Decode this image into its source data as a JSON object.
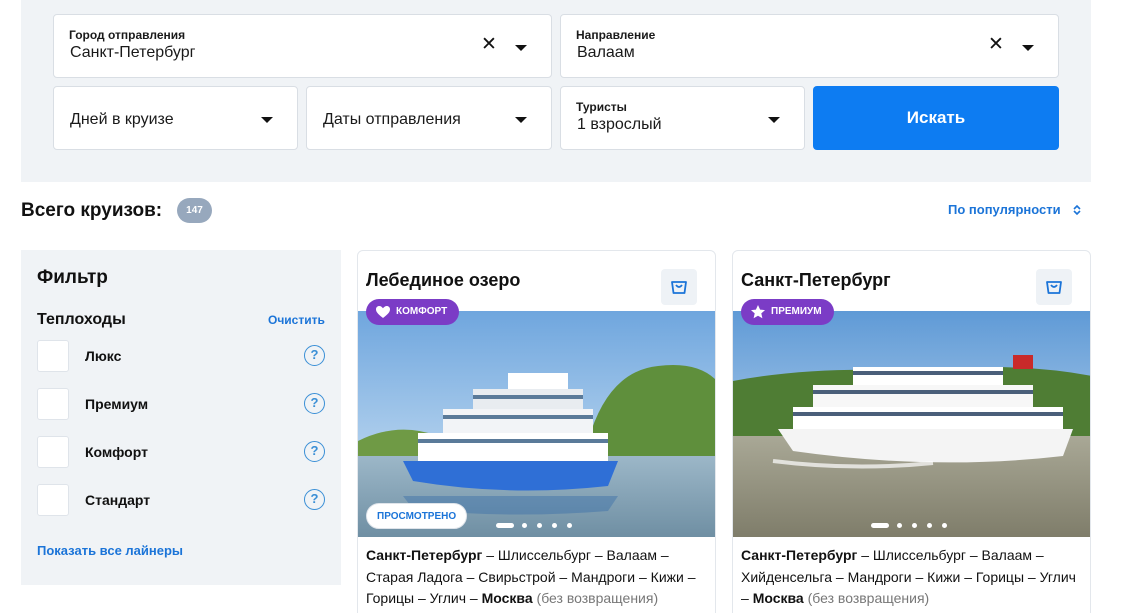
{
  "search": {
    "departure_label": "Город отправления",
    "departure_value": "Санкт-Петербург",
    "direction_label": "Направление",
    "direction_value": "Валаам",
    "days_placeholder": "Дней в круизе",
    "dates_placeholder": "Даты отправления",
    "tourists_label": "Туристы",
    "tourists_value": "1 взрослый",
    "search_button": "Искать",
    "clear_icon": "close-icon",
    "dropdown_icon": "chevron-down-icon"
  },
  "results": {
    "total_label": "Всего круизов:",
    "total_count": "147",
    "sort_label": "По популярности"
  },
  "filter": {
    "title": "Фильтр",
    "section_title": "Теплоходы",
    "clear_label": "Очистить",
    "options": [
      {
        "label": "Люкс",
        "help": "?"
      },
      {
        "label": "Премиум",
        "help": "?"
      },
      {
        "label": "Комфорт",
        "help": "?"
      },
      {
        "label": "Стандарт",
        "help": "?"
      }
    ],
    "show_all": "Показать все лайнеры"
  },
  "cards": [
    {
      "title": "Лебединое озеро",
      "tag": "КОМФОРТ",
      "tag_icon": "heart-icon",
      "tag_color": "#7b3cc6",
      "viewed": "ПРОСМОТРЕНО",
      "hull_color": "#2f6fd6",
      "route_start": "Санкт-Петербург",
      "route_middle": " – Шлиссельбург – Валаам – Старая Ладога – Свирьстрой – Мандроги – Кижи – Горицы – Углич – ",
      "route_end": "Москва",
      "route_note": " (без возвращения)"
    },
    {
      "title": "Санкт-Петербург",
      "tag": "ПРЕМИУМ",
      "tag_icon": "star-icon",
      "tag_color": "#7b3cc6",
      "viewed": "",
      "hull_color": "#f4f4f4",
      "route_start": "Санкт-Петербург",
      "route_middle": " – Шлиссельбург – Валаам – Хийденсельга – Мандроги – Кижи – Горицы – Углич – ",
      "route_end": "Москва",
      "route_note": " (без возвращения)"
    }
  ],
  "colors": {
    "accent": "#0d7cf2",
    "link": "#1b74d8",
    "panel_bg": "#f0f3f6",
    "badge_bg": "#97a8bd"
  }
}
